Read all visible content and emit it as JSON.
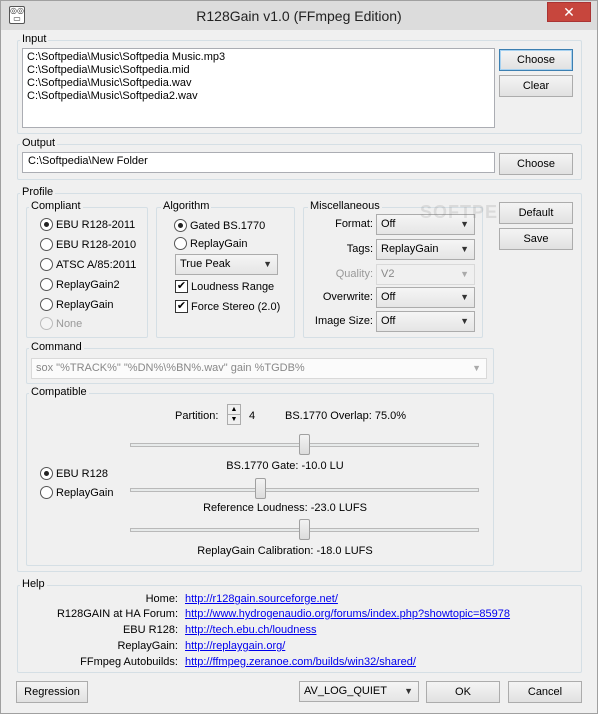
{
  "window": {
    "title": "R128Gain v1.0 (FFmpeg Edition)",
    "close_symbol": "✕"
  },
  "input": {
    "label": "Input",
    "files": [
      "C:\\Softpedia\\Music\\Softpedia Music.mp3",
      "C:\\Softpedia\\Music\\Softpedia.mid",
      "C:\\Softpedia\\Music\\Softpedia.wav",
      "C:\\Softpedia\\Music\\Softpedia2.wav"
    ],
    "choose_label": "Choose",
    "clear_label": "Clear"
  },
  "output": {
    "label": "Output",
    "value": "C:\\Softpedia\\New Folder",
    "choose_label": "Choose"
  },
  "profile": {
    "label": "Profile",
    "compliant": {
      "label": "Compliant",
      "options": [
        "EBU R128-2011",
        "EBU R128-2010",
        "ATSC A/85:2011",
        "ReplayGain2",
        "ReplayGain",
        "None"
      ],
      "selected": 0
    },
    "algorithm": {
      "label": "Algorithm",
      "options": [
        "Gated BS.1770",
        "ReplayGain"
      ],
      "selected": 0,
      "peak_mode": "True Peak",
      "loudness_range_label": "Loudness Range",
      "loudness_range_checked": true,
      "force_stereo_label": "Force Stereo (2.0)",
      "force_stereo_checked": true
    },
    "misc": {
      "label": "Miscellaneous",
      "format_label": "Format:",
      "format_value": "Off",
      "tags_label": "Tags:",
      "tags_value": "ReplayGain",
      "quality_label": "Quality:",
      "quality_value": "V2",
      "overwrite_label": "Overwrite:",
      "overwrite_value": "Off",
      "image_size_label": "Image Size:",
      "image_size_value": "Off"
    },
    "default_label": "Default",
    "save_label": "Save",
    "command_label": "Command",
    "command_value": "sox \"%TRACK%\" \"%DN%\\%BN%.wav\" gain %TGDB%",
    "compatible": {
      "label": "Compatible",
      "partition_label": "Partition:",
      "partition_value": "4",
      "overlap_text": "BS.1770 Overlap:  75.0%",
      "modes": [
        "EBU R128",
        "ReplayGain"
      ],
      "mode_selected": 0,
      "gate_text": "BS.1770 Gate: -10.0 LU",
      "gate_level": 0.5,
      "reference_text": "Reference Loudness: -23.0 LUFS",
      "reference_level": 0.37,
      "calibration_text": "ReplayGain Calibration: -18.0 LUFS",
      "calibration_level": 0.5
    }
  },
  "help": {
    "label": "Help",
    "rows": [
      {
        "name": "Home:",
        "url": "http://r128gain.sourceforge.net/"
      },
      {
        "name": "R128GAIN at HA Forum:",
        "url": "http://www.hydrogenaudio.org/forums/index.php?showtopic=85978"
      },
      {
        "name": "EBU R128:",
        "url": "http://tech.ebu.ch/loudness"
      },
      {
        "name": "ReplayGain:",
        "url": "http://replaygain.org/"
      },
      {
        "name": "FFmpeg Autobuilds:",
        "url": "http://ffmpeg.zeranoe.com/builds/win32/shared/"
      }
    ]
  },
  "footer": {
    "regression_label": "Regression",
    "log_level": "AV_LOG_QUIET",
    "ok_label": "OK",
    "cancel_label": "Cancel"
  },
  "watermark": {
    "text": "SOFTPEDIA"
  }
}
